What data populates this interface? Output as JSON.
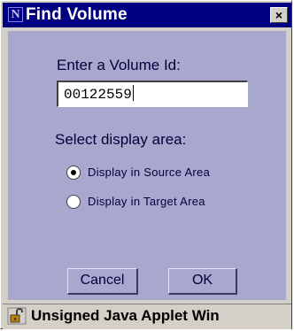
{
  "window": {
    "title": "Find Volume",
    "app_icon_letter": "N",
    "close_symbol": "×"
  },
  "form": {
    "volume_label": "Enter a Volume Id:",
    "volume_value": "00122559",
    "area_label": "Select display area:",
    "options": [
      {
        "label": "Display in Source Area",
        "checked": true
      },
      {
        "label": "Display in Target Area",
        "checked": false
      }
    ]
  },
  "buttons": {
    "cancel": "Cancel",
    "ok": "OK"
  },
  "status": {
    "text": "Unsigned Java Applet Win",
    "icon": "broken-lock-icon"
  },
  "colors": {
    "title_bar": "#000080",
    "panel": "#a8a8ce",
    "chrome": "#d4d0c8"
  }
}
